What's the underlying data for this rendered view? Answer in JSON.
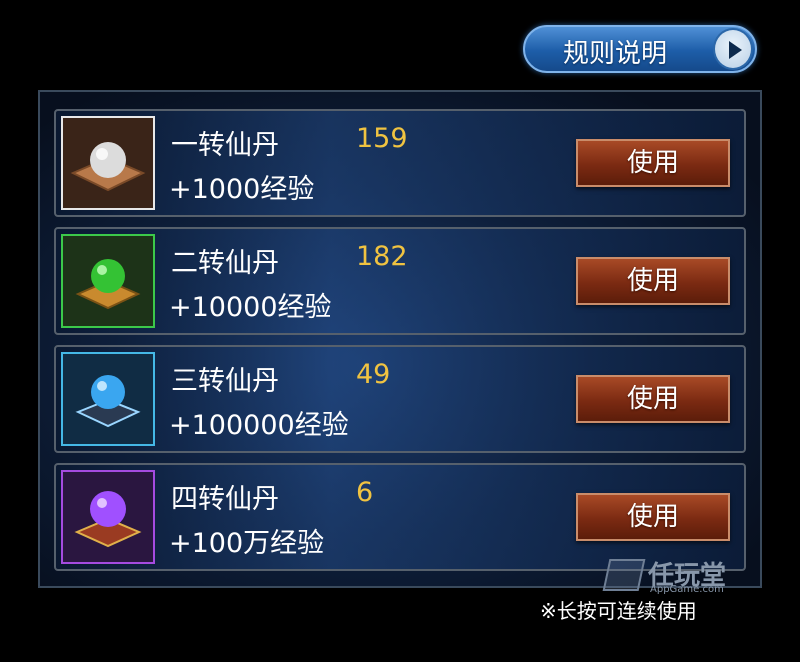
{
  "rules_button": {
    "label": "规则说明",
    "icon": "play-arrow-icon"
  },
  "items": [
    {
      "name": "一转仙丹",
      "count": "159",
      "exp": "+1000经验",
      "use_label": "使用",
      "frame_color": "#e8e8e8",
      "orb_color": "#dcdcdc",
      "orb_label": "white-pill-icon"
    },
    {
      "name": "二转仙丹",
      "count": "182",
      "exp": "+10000经验",
      "use_label": "使用",
      "frame_color": "#3cc94a",
      "orb_color": "#34c234",
      "orb_label": "green-pill-icon"
    },
    {
      "name": "三转仙丹",
      "count": "49",
      "exp": "+100000经验",
      "use_label": "使用",
      "frame_color": "#45b8e6",
      "orb_color": "#3aa6f0",
      "orb_label": "blue-pill-icon"
    },
    {
      "name": "四转仙丹",
      "count": "6",
      "exp": "+100万经验",
      "use_label": "使用",
      "frame_color": "#a54be0",
      "orb_color": "#a050ff",
      "orb_label": "purple-pill-icon"
    }
  ],
  "hint": "※长按可连续使用",
  "watermark": {
    "title": "任玩堂",
    "subtitle": "AppGame.com"
  }
}
